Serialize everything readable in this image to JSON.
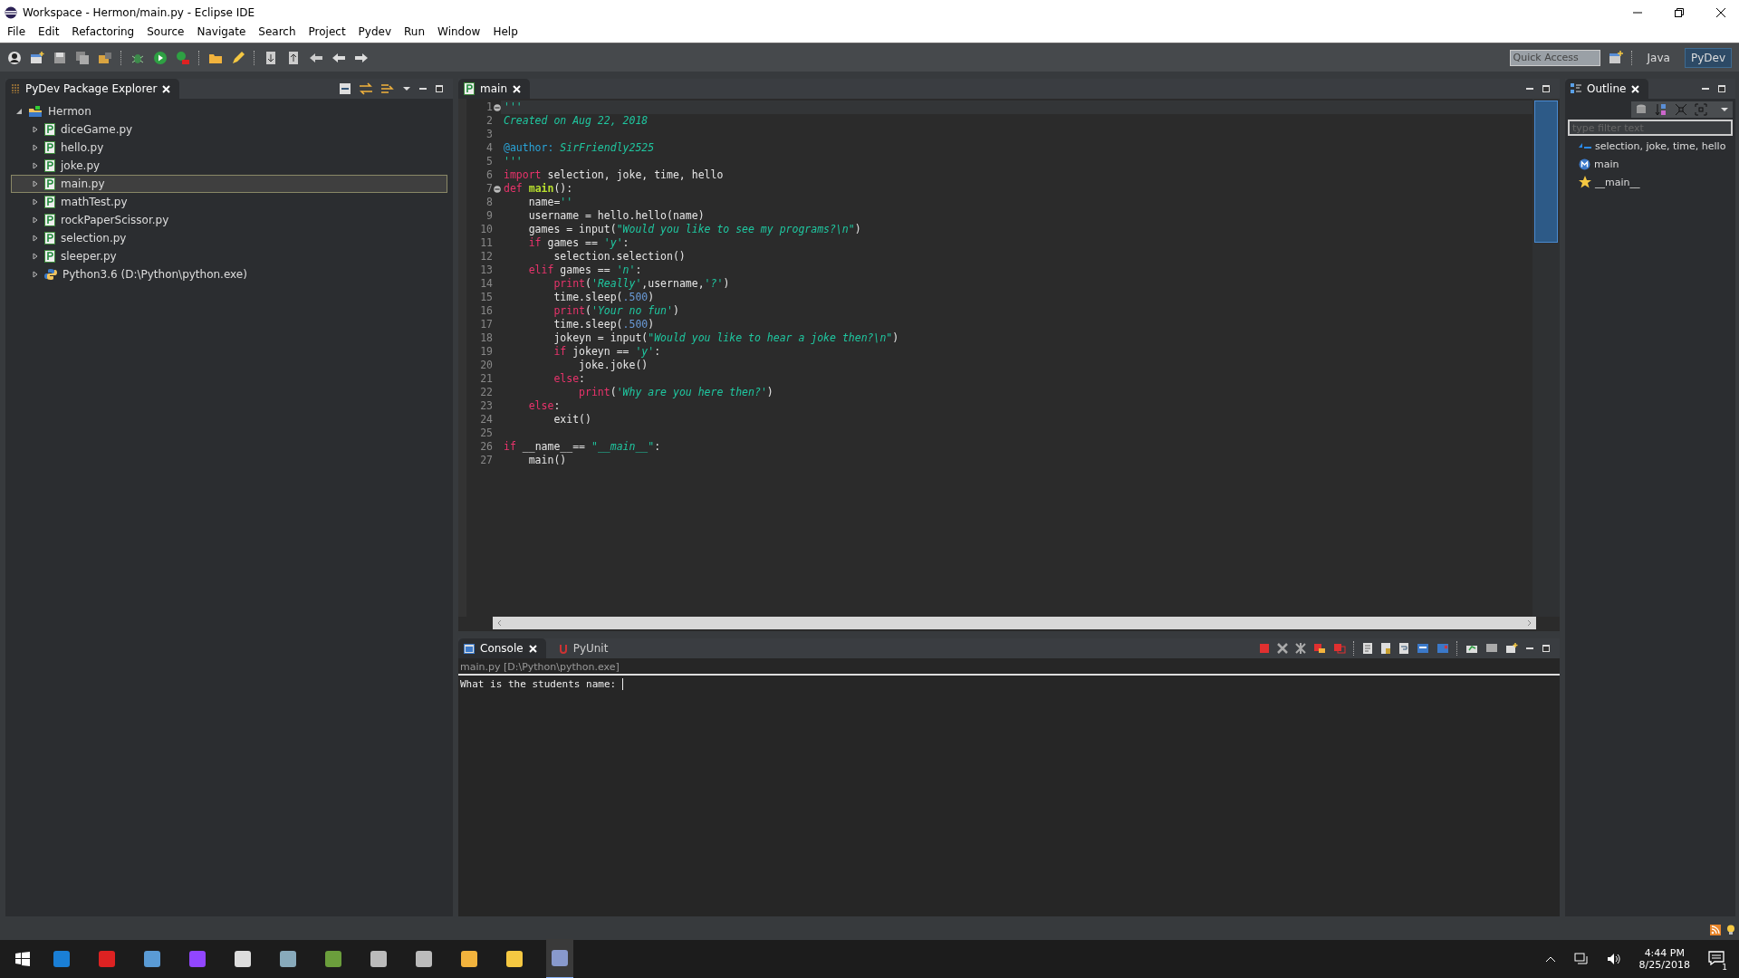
{
  "window": {
    "title": "Workspace - Hermon/main.py - Eclipse IDE"
  },
  "menu": [
    "File",
    "Edit",
    "Refactoring",
    "Source",
    "Navigate",
    "Search",
    "Project",
    "Pydev",
    "Run",
    "Window",
    "Help"
  ],
  "toolbar": {
    "quick_access": {
      "placeholder": "Quick Access"
    },
    "perspectives": [
      {
        "label": "Java",
        "selected": false
      },
      {
        "label": "PyDev",
        "selected": true
      }
    ]
  },
  "explorer": {
    "title": "PyDev Package Explorer",
    "tree": [
      {
        "label": "Hermon",
        "kind": "project",
        "expanded": true,
        "selected": false,
        "children": [
          {
            "label": "diceGame.py",
            "kind": "file",
            "expanded": false,
            "selected": false
          },
          {
            "label": "hello.py",
            "kind": "file",
            "expanded": false,
            "selected": false
          },
          {
            "label": "joke.py",
            "kind": "file",
            "expanded": false,
            "selected": false
          },
          {
            "label": "main.py",
            "kind": "file",
            "expanded": false,
            "selected": true
          },
          {
            "label": "mathTest.py",
            "kind": "file",
            "expanded": false,
            "selected": false
          },
          {
            "label": "rockPaperScissor.py",
            "kind": "file",
            "expanded": false,
            "selected": false
          },
          {
            "label": "selection.py",
            "kind": "file",
            "expanded": false,
            "selected": false
          },
          {
            "label": "sleeper.py",
            "kind": "file",
            "expanded": false,
            "selected": false
          },
          {
            "label": "Python3.6  (D:\\Python\\python.exe)",
            "kind": "interpreter",
            "expanded": false,
            "selected": false
          }
        ]
      }
    ]
  },
  "editor": {
    "tabs": [
      {
        "label": "main",
        "selected": true
      }
    ],
    "lines": [
      {
        "number": "1",
        "fold": true,
        "tokens": [
          {
            "kind": "str",
            "text": "'''"
          }
        ]
      },
      {
        "number": "2",
        "fold": false,
        "tokens": [
          {
            "kind": "str",
            "text": "Created on Aug 22, 2018"
          }
        ]
      },
      {
        "number": "3",
        "fold": false
      },
      {
        "number": "4",
        "fold": false,
        "tokens": [
          {
            "kind": "deco",
            "text": "@author:"
          },
          {
            "kind": "str",
            "text": " SirFriendly2525"
          }
        ]
      },
      {
        "number": "5",
        "fold": false,
        "tokens": [
          {
            "kind": "str",
            "text": "'''"
          }
        ]
      },
      {
        "number": "6",
        "fold": false,
        "tokens": [
          {
            "kind": "kw",
            "text": "import"
          },
          {
            "kind": "plain",
            "text": " selection, joke, time, hello"
          }
        ]
      },
      {
        "number": "7",
        "fold": true,
        "tokens": [
          {
            "kind": "kw",
            "text": "def"
          },
          {
            "kind": "fn",
            "text": " main"
          },
          {
            "kind": "plain",
            "text": "():"
          }
        ]
      },
      {
        "number": "8",
        "fold": false,
        "tokens": [
          {
            "kind": "plain",
            "text": "    name="
          },
          {
            "kind": "str",
            "text": "''"
          }
        ]
      },
      {
        "number": "9",
        "fold": false,
        "tokens": [
          {
            "kind": "plain",
            "text": "    username = hello.hello(name)"
          }
        ]
      },
      {
        "number": "10",
        "fold": false,
        "tokens": [
          {
            "kind": "plain",
            "text": "    games = input("
          },
          {
            "kind": "str",
            "text": "\"Would you like to see my programs?\\n\""
          },
          {
            "kind": "plain",
            "text": ")"
          }
        ]
      },
      {
        "number": "11",
        "fold": false,
        "tokens": [
          {
            "kind": "kw",
            "text": "    if"
          },
          {
            "kind": "plain",
            "text": " games == "
          },
          {
            "kind": "str",
            "text": "'y'"
          },
          {
            "kind": "plain",
            "text": ":"
          }
        ]
      },
      {
        "number": "12",
        "fold": false,
        "tokens": [
          {
            "kind": "plain",
            "text": "        selection.selection()"
          }
        ]
      },
      {
        "number": "13",
        "fold": false,
        "tokens": [
          {
            "kind": "kw",
            "text": "    elif"
          },
          {
            "kind": "plain",
            "text": " games == "
          },
          {
            "kind": "str",
            "text": "'n'"
          },
          {
            "kind": "plain",
            "text": ":"
          }
        ]
      },
      {
        "number": "14",
        "fold": false,
        "tokens": [
          {
            "kind": "kw",
            "text": "        print"
          },
          {
            "kind": "plain",
            "text": "("
          },
          {
            "kind": "str",
            "text": "'Really'"
          },
          {
            "kind": "plain",
            "text": ",username,"
          },
          {
            "kind": "str",
            "text": "'?'"
          },
          {
            "kind": "plain",
            "text": ")"
          }
        ]
      },
      {
        "number": "15",
        "fold": false,
        "tokens": [
          {
            "kind": "plain",
            "text": "        time.sleep("
          },
          {
            "kind": "num",
            "text": ".500"
          },
          {
            "kind": "plain",
            "text": ")"
          }
        ]
      },
      {
        "number": "16",
        "fold": false,
        "tokens": [
          {
            "kind": "kw",
            "text": "        print"
          },
          {
            "kind": "plain",
            "text": "("
          },
          {
            "kind": "str",
            "text": "'Your no fun'"
          },
          {
            "kind": "plain",
            "text": ")"
          }
        ]
      },
      {
        "number": "17",
        "fold": false,
        "tokens": [
          {
            "kind": "plain",
            "text": "        time.sleep("
          },
          {
            "kind": "num",
            "text": ".500"
          },
          {
            "kind": "plain",
            "text": ")"
          }
        ]
      },
      {
        "number": "18",
        "fold": false,
        "tokens": [
          {
            "kind": "plain",
            "text": "        jokeyn = input("
          },
          {
            "kind": "str",
            "text": "\"Would you like to hear a joke then?\\n\""
          },
          {
            "kind": "plain",
            "text": ")"
          }
        ]
      },
      {
        "number": "19",
        "fold": false,
        "tokens": [
          {
            "kind": "kw",
            "text": "        if"
          },
          {
            "kind": "plain",
            "text": " jokeyn == "
          },
          {
            "kind": "str",
            "text": "'y'"
          },
          {
            "kind": "plain",
            "text": ":"
          }
        ]
      },
      {
        "number": "20",
        "fold": false,
        "tokens": [
          {
            "kind": "plain",
            "text": "            joke.joke()"
          }
        ]
      },
      {
        "number": "21",
        "fold": false,
        "tokens": [
          {
            "kind": "kw",
            "text": "        else"
          },
          {
            "kind": "plain",
            "text": ":"
          }
        ]
      },
      {
        "number": "22",
        "fold": false,
        "tokens": [
          {
            "kind": "kw",
            "text": "            print"
          },
          {
            "kind": "plain",
            "text": "("
          },
          {
            "kind": "str",
            "text": "'Why are you here then?'"
          },
          {
            "kind": "plain",
            "text": ")"
          }
        ]
      },
      {
        "number": "23",
        "fold": false,
        "tokens": [
          {
            "kind": "kw",
            "text": "    else"
          },
          {
            "kind": "plain",
            "text": ":"
          }
        ]
      },
      {
        "number": "24",
        "fold": false,
        "tokens": [
          {
            "kind": "plain",
            "text": "        exit()"
          }
        ]
      },
      {
        "number": "25",
        "fold": false
      },
      {
        "number": "26",
        "fold": false,
        "tokens": [
          {
            "kind": "kw",
            "text": "if"
          },
          {
            "kind": "plain",
            "text": " __name__== "
          },
          {
            "kind": "str",
            "text": "\"__main__\""
          },
          {
            "kind": "plain",
            "text": ":"
          }
        ]
      },
      {
        "number": "27",
        "fold": false,
        "tokens": [
          {
            "kind": "plain",
            "text": "    main()"
          }
        ]
      }
    ]
  },
  "outline": {
    "title": "Outline",
    "filter": {
      "placeholder": "type filter text"
    },
    "items": [
      {
        "kind": "import",
        "label": "selection, joke, time, hello"
      },
      {
        "kind": "function",
        "label": "main"
      },
      {
        "kind": "main",
        "label": "__main__"
      }
    ]
  },
  "console": {
    "tabs": [
      {
        "label": "Console",
        "selected": true
      },
      {
        "label": "PyUnit",
        "selected": false
      }
    ],
    "process": "main.py [D:\\Python\\python.exe]",
    "output": "What is the students name: "
  },
  "taskbar": {
    "time": "4:44 PM",
    "date": "8/25/2018",
    "notifications": "1"
  }
}
